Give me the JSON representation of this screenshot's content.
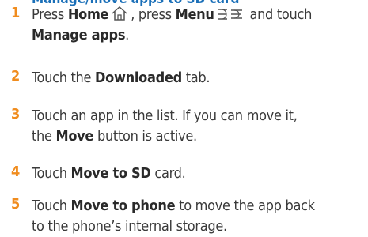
{
  "heading": "Manage/move apps to SD card",
  "steps": [
    {
      "number": "1",
      "parts": {
        "p1": "Press ",
        "b1": "Home",
        "p2": ", press ",
        "b2": "Menu",
        "p3": " and touch",
        "b3": "Manage apps",
        "p4": "."
      },
      "icons": [
        "home-icon",
        "menu-icon"
      ]
    },
    {
      "number": "2",
      "parts": {
        "p1": "Touch the ",
        "b1": "Downloaded",
        "p2": " tab."
      }
    },
    {
      "number": "3",
      "parts": {
        "p1": "Touch an app in the list. If you can move it,",
        "p2": "the ",
        "b1": "Move",
        "p3": " button is active."
      }
    },
    {
      "number": "4",
      "parts": {
        "p1": "Touch ",
        "b1": "Move to SD",
        "p2": " card."
      }
    },
    {
      "number": "5",
      "parts": {
        "p1": "Touch ",
        "b1": "Move to phone",
        "p2": " to move the app back",
        "p3": "to the phone’s internal storage."
      }
    }
  ],
  "colors": {
    "number": "#f08c1e",
    "heading": "#1a6fb8",
    "text": "#3a3a3a"
  }
}
